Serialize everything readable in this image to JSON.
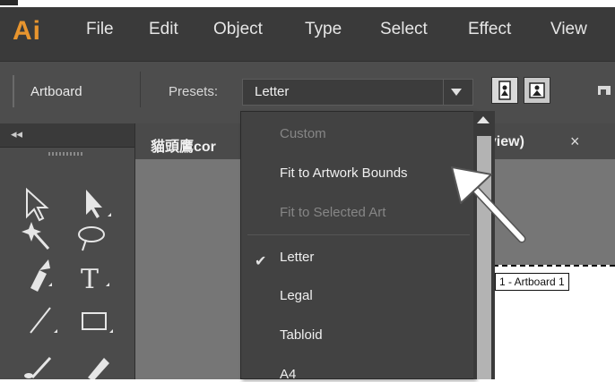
{
  "app": {
    "logo": "Ai",
    "menu": [
      "File",
      "Edit",
      "Object",
      "Type",
      "Select",
      "Effect",
      "View"
    ]
  },
  "control_bar": {
    "mode_label": "Artboard",
    "presets_label": "Presets:",
    "presets_value": "Letter"
  },
  "tabs": {
    "doc_title": "貓頭鷹cor",
    "doc_title_suffix": "eview)",
    "close": "×"
  },
  "dropdown": {
    "items": [
      {
        "label": "Custom",
        "enabled": false
      },
      {
        "label": "Fit to Artwork Bounds",
        "enabled": true
      },
      {
        "label": "Fit to Selected Art",
        "enabled": false
      },
      {
        "label": "Letter",
        "enabled": true,
        "checked": true
      },
      {
        "label": "Legal",
        "enabled": true
      },
      {
        "label": "Tabloid",
        "enabled": true
      },
      {
        "label": "A4",
        "enabled": true
      }
    ],
    "check_mark": "✔"
  },
  "canvas": {
    "artboard_label": "1 - Artboard 1"
  },
  "toolbar_icons": [
    "selection-tool-icon",
    "direct-selection-tool-icon",
    "magic-wand-tool-icon",
    "lasso-tool-icon",
    "pen-tool-icon",
    "type-tool-icon",
    "line-tool-icon",
    "rectangle-tool-icon",
    "paintbrush-tool-icon",
    "pencil-tool-icon"
  ],
  "colors": {
    "logo": "#e8952e",
    "chrome_dark": "#3a3a3a",
    "canvas": "#767676"
  }
}
